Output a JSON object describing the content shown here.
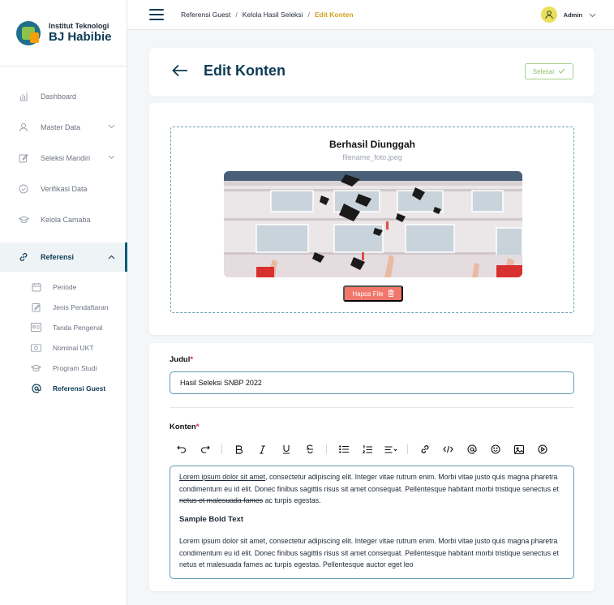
{
  "sidebar": {
    "logo_small": "Institut Teknologi",
    "logo_big": "BJ Habibie",
    "items": [
      {
        "label": "Dashboard",
        "icon": "chart-icon"
      },
      {
        "label": "Master Data",
        "icon": "user-icon"
      },
      {
        "label": "Seleksi Mandiri",
        "icon": "edit-icon"
      },
      {
        "label": "Verifikasi Data",
        "icon": "check-circle-icon"
      },
      {
        "label": "Kelola Camaba",
        "icon": "graduation-cap-icon"
      },
      {
        "label": "Referensi",
        "icon": "link-icon"
      }
    ],
    "sub_items": [
      {
        "label": "Periode",
        "icon": "calendar-icon"
      },
      {
        "label": "Jenis Pendaftaran",
        "icon": "edit-doc-icon"
      },
      {
        "label": "Tanda Pengenal",
        "icon": "id-card-icon"
      },
      {
        "label": "Nominal UKT",
        "icon": "money-icon"
      },
      {
        "label": "Program Studi",
        "icon": "graduation-cap-icon"
      },
      {
        "label": "Referensi Guest",
        "icon": "at-sign-icon"
      }
    ]
  },
  "topbar": {
    "breadcrumbs": [
      "Referensi Guest",
      "Kelola Hasil Seleksi",
      "Edit Konten"
    ],
    "separator": "/",
    "user_name": "Admin"
  },
  "header": {
    "title": "Edit Konten",
    "done_label": "Selesai"
  },
  "upload": {
    "status": "Berhasil Diunggah",
    "filename": "filename_foto.jpeg",
    "remove_label": "Hapus File"
  },
  "form": {
    "title_label": "Judul",
    "title_value": "Hasil Seleksi SNBP 2022",
    "content_label": "Konten",
    "required_mark": "*",
    "p1_underlined": "Lorem ipsum dolor sit amet",
    "p1_mid": ", consectetur adipiscing elit. Integer vitae rutrum enim. Morbi vitae justo quis magna pharetra condimentum eu id elit. Donec finibus sagittis risus sit amet consequat. Pellentesque habitant morbi tristique senectus et ",
    "p1_strike": "netus et malesuada fames",
    "p1_end": " ac turpis egestas.",
    "heading": "Sample Bold Text",
    "p2": "Lorem ipsum dolor sit amet, consectetur adipiscing elit. Integer vitae rutrum enim. Morbi vitae justo quis magna pharetra condimentum eu id elit. Donec finibus sagittis risus sit amet consequat. Pellentesque habitant morbi tristique senectus et netus et malesuada fames ac turpis egestas. Pellentesque auctor eget leo"
  },
  "toolbar_icons": [
    "undo-icon",
    "redo-icon",
    "bold-icon",
    "italic-icon",
    "underline-icon",
    "strikethrough-icon",
    "bullet-list-icon",
    "numbered-list-icon",
    "align-icon",
    "link-icon",
    "code-icon",
    "mention-icon",
    "emoji-icon",
    "image-icon",
    "video-icon"
  ],
  "colors": {
    "primary": "#0d3b56",
    "accent": "#d4a017",
    "danger": "#f0776a",
    "success": "#8fc06f"
  }
}
